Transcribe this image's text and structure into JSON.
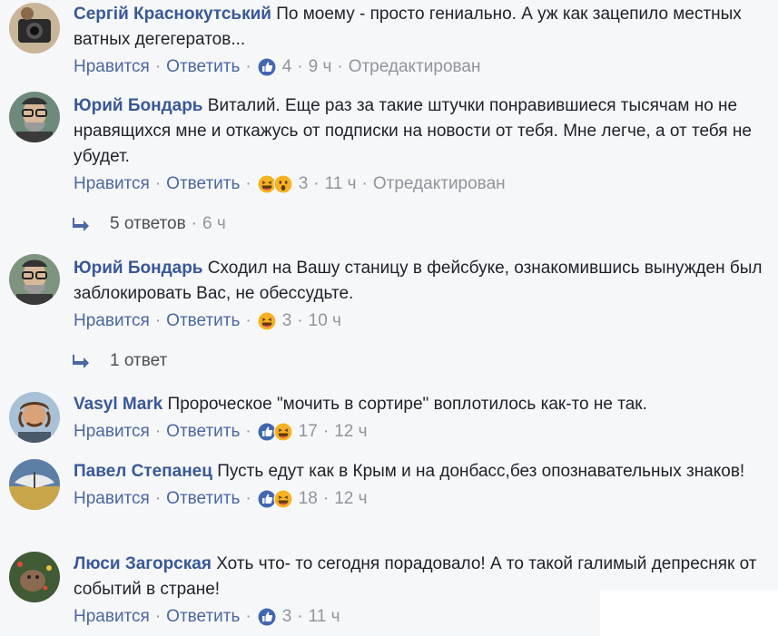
{
  "labels": {
    "like": "Нравится",
    "reply": "Ответить",
    "edited": "Отредактирован",
    "sep": "·"
  },
  "comments": [
    {
      "author": "Сергій Краснокутський",
      "text": "По моему - просто гениально. А уж как зацепило местных ватных дегегератов...",
      "reactions": [
        "like-icon"
      ],
      "count": "4",
      "time": "9 ч",
      "edited": true
    },
    {
      "author": "Юрий Бондарь",
      "text": "Виталий. Еще раз за такие штучки понравившиеся тысячам но не нравящихся мне и откажусь от подписки на новости от тебя. Мне легче, а от тебя не убудет.",
      "reactions": [
        "haha-icon",
        "wow-icon"
      ],
      "count": "3",
      "time": "11 ч",
      "edited": true,
      "replies": {
        "label": "5 ответов",
        "time": "6 ч"
      }
    },
    {
      "author": "Юрий Бондарь",
      "text": "Сходил на Вашу станицу в фейсбуке, ознакомившись вынужден был заблокировать Вас, не обессудьте.",
      "reactions": [
        "haha-icon"
      ],
      "count": "3",
      "time": "10 ч",
      "edited": false,
      "replies": {
        "label": "1 ответ",
        "time": ""
      }
    },
    {
      "author": "Vasyl Mark",
      "text": "Пророческое \"мочить в сортире\" воплотилось как-то не так.",
      "reactions": [
        "like-icon",
        "haha-icon"
      ],
      "count": "17",
      "time": "12 ч",
      "edited": false
    },
    {
      "author": "Павел Степанец",
      "text": "Пусть едут как в Крым и на донбасс,без опознавательных знаков!",
      "reactions": [
        "like-icon",
        "haha-icon"
      ],
      "count": "18",
      "time": "12 ч",
      "edited": false
    },
    {
      "author": "Люси Загорская",
      "text": "Хоть что- то сегодня порадовало! А то такой галимый депресняк от событий в стране!",
      "reactions": [
        "like-icon"
      ],
      "count": "3",
      "time": "11 ч",
      "edited": false
    }
  ],
  "colors": {
    "link": "#385898",
    "muted": "#90949c",
    "like_blue": "#4267b2",
    "haha_yellow": "#f7b125"
  }
}
